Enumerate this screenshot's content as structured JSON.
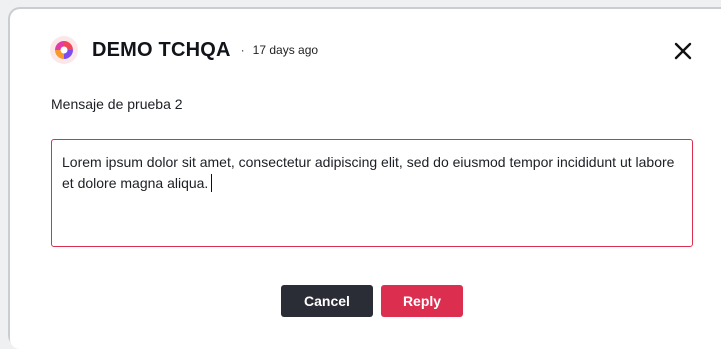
{
  "header": {
    "username": "DEMO TCHQA",
    "separator": "·",
    "time": "17 days ago",
    "avatar_icon": "colorful-logo-icon",
    "close_icon": "close-icon"
  },
  "message": {
    "text": "Mensaje de prueba 2"
  },
  "reply": {
    "value": "Lorem ipsum dolor sit amet, consectetur adipiscing elit, sed do eiusmod tempor incididunt ut labore et dolore magna aliqua."
  },
  "actions": {
    "cancel_label": "Cancel",
    "reply_label": "Reply"
  },
  "colors": {
    "accent": "#dc2f50",
    "dark_button": "#2b2d36"
  }
}
